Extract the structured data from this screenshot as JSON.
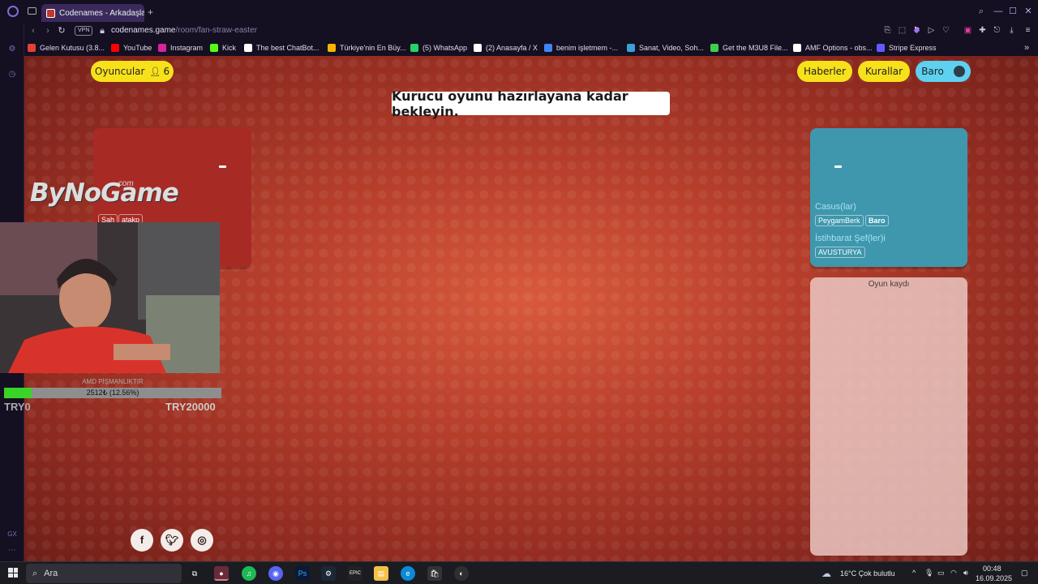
{
  "browser": {
    "tab_title": "Codenames - Arkadaşları",
    "url_host": "codenames.game",
    "url_path": "/room/fan-straw-easter",
    "vpn_label": "VPN",
    "accent": "#3a2a5c"
  },
  "bookmarks": [
    {
      "label": "Gelen Kutusu (3.8...",
      "icon_color": "#e44134",
      "icon": "gmail-icon"
    },
    {
      "label": "YouTube",
      "icon_color": "#ff0000",
      "icon": "youtube-icon"
    },
    {
      "label": "Instagram",
      "icon_color": "#d6249f",
      "icon": "instagram-icon"
    },
    {
      "label": "Kick",
      "icon_color": "#53fc18",
      "icon": "kick-icon"
    },
    {
      "label": "The best ChatBot...",
      "icon_color": "#ffffff",
      "icon": "chatgpt-icon"
    },
    {
      "label": "Türkiye'nin En Büy...",
      "icon_color": "#f5b400",
      "icon": "site-icon"
    },
    {
      "label": "(5) WhatsApp",
      "icon_color": "#25d366",
      "icon": "whatsapp-icon"
    },
    {
      "label": "(2) Anasayfa / X",
      "icon_color": "#ffffff",
      "icon": "x-icon"
    },
    {
      "label": "benim işletmem -...",
      "icon_color": "#4285f4",
      "icon": "google-icon"
    },
    {
      "label": "Sanat, Video, Soh...",
      "icon_color": "#3aa0d8",
      "icon": "site-icon"
    },
    {
      "label": "Get the M3U8 File...",
      "icon_color": "#3ccf4e",
      "icon": "site-icon"
    },
    {
      "label": "AMF Options - obs...",
      "icon_color": "#ffffff",
      "icon": "github-icon"
    },
    {
      "label": "Stripe Express",
      "icon_color": "#635bff",
      "icon": "stripe-icon"
    }
  ],
  "game": {
    "players_label": "Oyuncular",
    "players_count": "6",
    "news_label": "Haberler",
    "rules_label": "Kurallar",
    "user_label": "Baro",
    "banner": "Kurucu oyunu hazırlayana kadar bekleyin.",
    "red_team": {
      "score": "-",
      "chips": [
        "Şah",
        "atakp"
      ]
    },
    "blue_team": {
      "score": "-",
      "operatives_label": "Casus(lar)",
      "operatives": [
        "PeygamBerk",
        "Baro"
      ],
      "spymasters_label": "İstihbarat Şef(ler)i",
      "spymasters": [
        "AVUSTURYA"
      ]
    },
    "log_title": "Oyun kaydı"
  },
  "overlay": {
    "logo": "ByNoGame",
    "logo_suffix": ".com",
    "donate_title": "AMD PİŞMANLIKTIR",
    "progress_text": "2512₺ (12.56%)",
    "progress_fraction": 0.1256,
    "goal_left": "TRY0",
    "goal_right": "TRY20000"
  },
  "taskbar": {
    "search_placeholder": "Ara",
    "weather": "16°C  Çok bulutlu",
    "time": "00:48",
    "date": "16.09.2025"
  }
}
